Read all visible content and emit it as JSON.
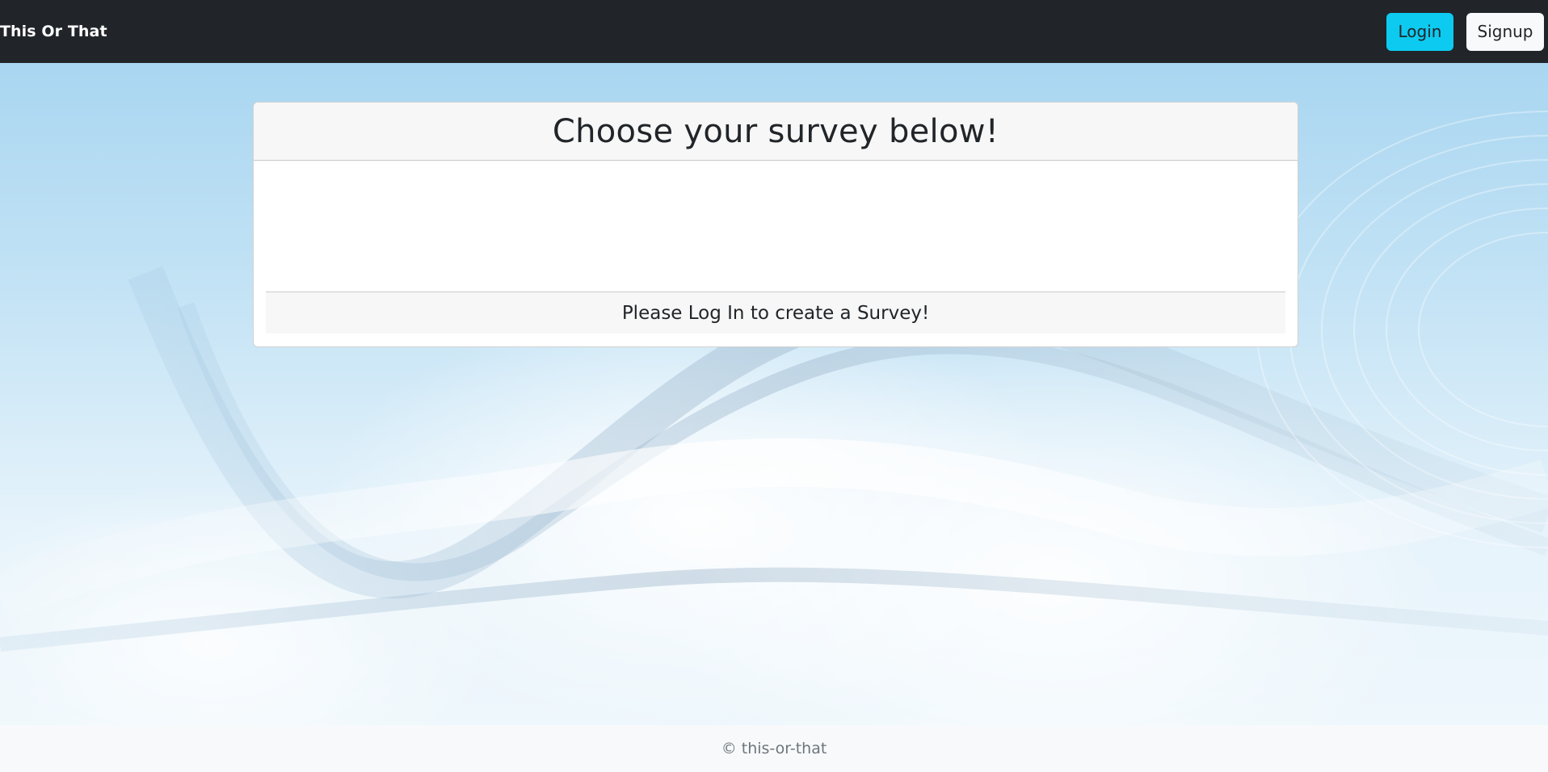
{
  "navbar": {
    "brand": "This Or That",
    "login_label": "Login",
    "signup_label": "Signup"
  },
  "card": {
    "title": "Choose your survey below!",
    "footer_text": "Please Log In to create a Survey!"
  },
  "footer": {
    "copyright": "© this-or-that"
  },
  "colors": {
    "navbar_bg": "#212529",
    "login_button": "#0dcaf0",
    "signup_button": "#f8f9fa",
    "footer_bg": "#f8f9fa"
  }
}
